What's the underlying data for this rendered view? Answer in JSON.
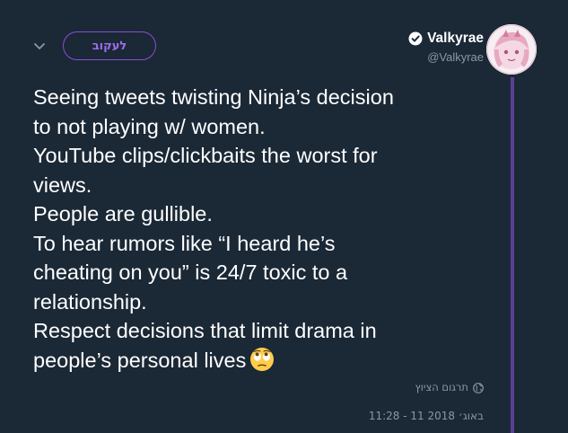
{
  "header": {
    "follow_label": "לעקוב",
    "author_name": "Valkyrae",
    "author_handle": "@Valkyrae",
    "verified_icon": "verified-badge",
    "more_icon": "chevron-down"
  },
  "tweet": {
    "lines": [
      "Seeing tweets twisting Ninja’s decision",
      "to not playing w/ women.",
      "YouTube clips/clickbaits the worst for",
      "views.",
      "People are gullible.",
      "To hear rumors like “I heard he’s",
      "cheating on you” is 24/7 toxic to a",
      "relationship.",
      "Respect decisions that limit drama in",
      "people’s personal lives"
    ],
    "emoji": "face-with-rolling-eyes"
  },
  "footer": {
    "translate_label": "תרגום הציוץ",
    "translate_icon": "globe",
    "timestamp": "11:28 - 11 באוג׳ 2018"
  },
  "colors": {
    "background": "#1b2836",
    "accent": "#8a4dd6",
    "thread_line": "#5b3f94",
    "muted_text": "#8899a6"
  }
}
